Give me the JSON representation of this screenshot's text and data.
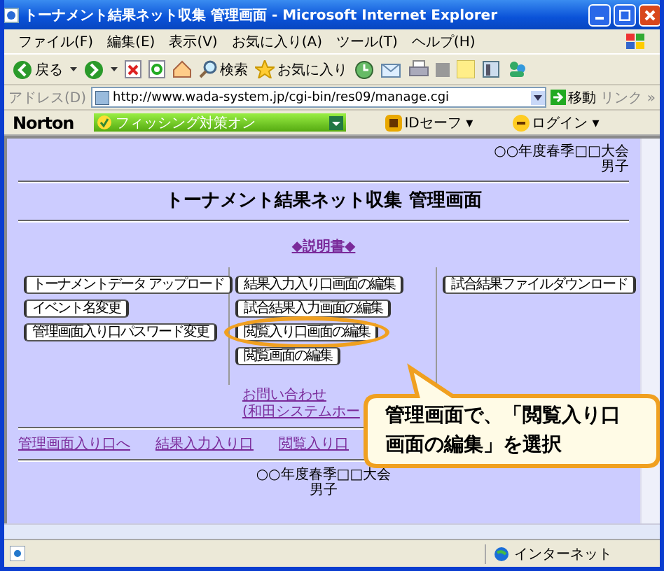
{
  "window": {
    "title": "トーナメント結果ネット収集 管理画面 - Microsoft Internet Explorer"
  },
  "menu": [
    "ファイル(F)",
    "編集(E)",
    "表示(V)",
    "お気に入り(A)",
    "ツール(T)",
    "ヘルプ(H)"
  ],
  "toolbar": {
    "back": "戻る",
    "search": "検索",
    "favorites": "お気に入り"
  },
  "address": {
    "label": "アドレス(D)",
    "url": "http://www.wada-system.jp/cgi-bin/res09/manage.cgi",
    "go": "移動",
    "links": "リンク »"
  },
  "norton": {
    "brand": "Norton",
    "phishing": "フィッシング対策オン",
    "idsafe": "IDセーフ ▾",
    "login": "ログイン ▾"
  },
  "page": {
    "event": "○○年度春季□□大会",
    "division": "男子",
    "heading": "トーナメント結果ネット収集 管理画面",
    "manual_link": "◆説明書◆",
    "columns": [
      [
        {
          "label": "トーナメントデータ アップロード",
          "highlighted": false
        },
        {
          "label": "イベント名変更",
          "highlighted": false
        },
        {
          "label": "管理画面入り口パスワード変更",
          "highlighted": false
        }
      ],
      [
        {
          "label": "結果入力入り口画面の編集",
          "highlighted": false
        },
        {
          "label": "試合結果入力画面の編集",
          "highlighted": false
        },
        {
          "label": "閲覧入り口画面の編集",
          "highlighted": true
        },
        {
          "label": "閲覧画面の編集",
          "highlighted": false
        }
      ],
      [
        {
          "label": "試合結果ファイルダウンロード",
          "highlighted": false
        }
      ]
    ],
    "contact": [
      "お問い合わせ",
      "(和田システムホー"
    ],
    "nav_links": [
      "管理画面入り口へ",
      "結果入力入り口",
      "閲覧入り口"
    ],
    "footer": [
      "○○年度春季□□大会",
      "男子"
    ]
  },
  "callout": {
    "text": "管理画面で、「閲覧入り口画面の編集」を選択"
  },
  "status_bar": {
    "zone": "インターネット"
  }
}
